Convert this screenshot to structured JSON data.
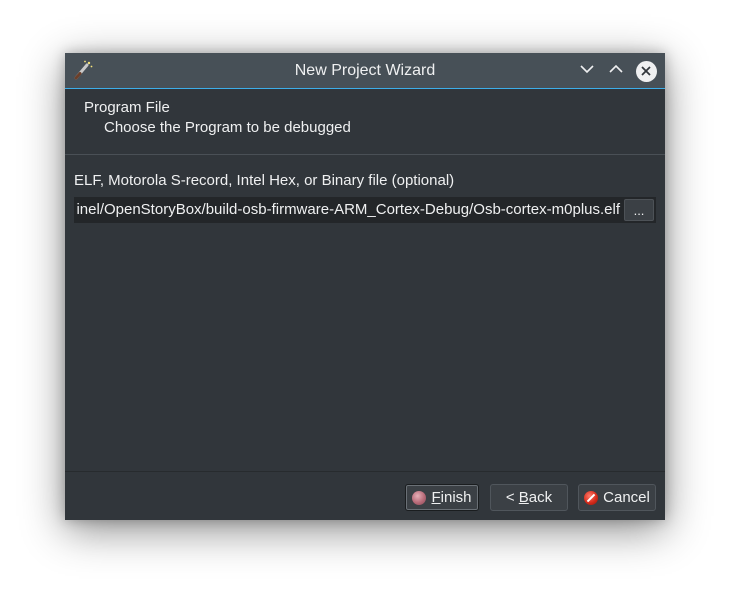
{
  "window": {
    "title": "New Project Wizard",
    "icons": {
      "app": "magic-wand-icon",
      "minimize": "chevron-down-icon",
      "maximize": "chevron-up-icon",
      "close": "close-icon"
    }
  },
  "header": {
    "title": "Program File",
    "subtitle": "Choose the Program to be debugged"
  },
  "form": {
    "label": "ELF, Motorola S-record, Intel Hex, or Binary file (optional)",
    "path_value": "inel/OpenStoryBox/build-osb-firmware-ARM_Cortex-Debug/Osb-cortex-m0plus.elf",
    "browse_label": "..."
  },
  "buttons": {
    "finish": {
      "mnemonic": "F",
      "rest": "inish",
      "icon": "finish-icon"
    },
    "back": {
      "prefix": "< ",
      "mnemonic": "B",
      "rest": "ack"
    },
    "cancel": {
      "label": "Cancel",
      "icon": "cancel-icon"
    }
  },
  "colors": {
    "accent": "#3daee9",
    "window_bg": "#31363b",
    "titlebar_bg": "#475057",
    "input_bg": "#232629"
  }
}
